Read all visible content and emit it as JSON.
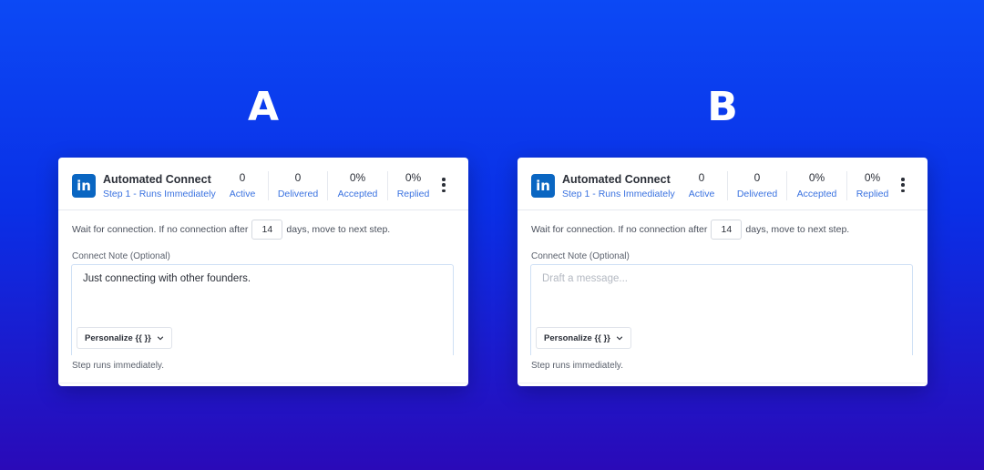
{
  "variants": [
    {
      "letter": "A",
      "card": {
        "title": "Automated Connect",
        "subtitle": "Step 1 - Runs Immediately",
        "stats": [
          {
            "value": "0",
            "label": "Active"
          },
          {
            "value": "0",
            "label": "Delivered"
          },
          {
            "value": "0%",
            "label": "Accepted"
          },
          {
            "value": "0%",
            "label": "Replied"
          }
        ],
        "wait_prefix": "Wait for connection. If no connection after",
        "wait_days": "14",
        "wait_suffix": "days, move to next step.",
        "note_label": "Connect Note (Optional)",
        "note_value": "Just connecting with other founders.",
        "note_placeholder": "",
        "personalize_label": "Personalize {{ }}",
        "footer": "Step runs immediately."
      }
    },
    {
      "letter": "B",
      "card": {
        "title": "Automated Connect",
        "subtitle": "Step 1 - Runs Immediately",
        "stats": [
          {
            "value": "0",
            "label": "Active"
          },
          {
            "value": "0",
            "label": "Delivered"
          },
          {
            "value": "0%",
            "label": "Accepted"
          },
          {
            "value": "0%",
            "label": "Replied"
          }
        ],
        "wait_prefix": "Wait for connection. If no connection after",
        "wait_days": "14",
        "wait_suffix": "days, move to next step.",
        "note_label": "Connect Note (Optional)",
        "note_value": "",
        "note_placeholder": "Draft a message...",
        "personalize_label": "Personalize {{ }}",
        "footer": "Step runs immediately."
      }
    }
  ],
  "icons": {
    "logo": "linkedin-icon",
    "menu": "kebab-menu-icon",
    "dropdown": "chevron-down-icon"
  },
  "colors": {
    "accent": "#3a72e0",
    "linkedin": "#0a66c2"
  }
}
